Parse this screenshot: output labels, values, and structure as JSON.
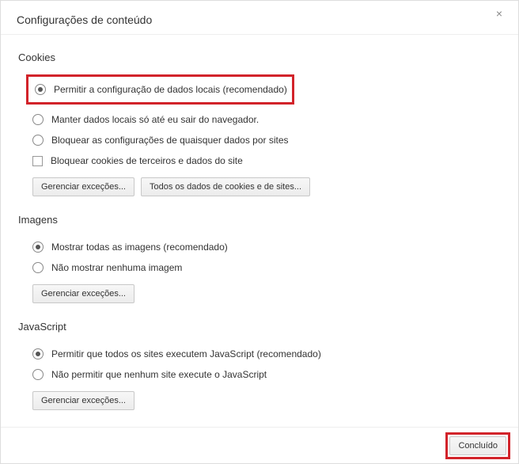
{
  "dialog": {
    "title": "Configurações de conteúdo",
    "close_label": "×"
  },
  "sections": {
    "cookies": {
      "title": "Cookies",
      "options": [
        {
          "label": "Permitir a configuração de dados locais (recomendado)",
          "checked": true
        },
        {
          "label": "Manter dados locais só até eu sair do navegador.",
          "checked": false
        },
        {
          "label": "Bloquear as configurações de quaisquer dados por sites",
          "checked": false
        }
      ],
      "checkbox": {
        "label": "Bloquear cookies de terceiros e dados do site",
        "checked": false
      },
      "buttons": {
        "manage": "Gerenciar exceções...",
        "alldata": "Todos os dados de cookies e de sites..."
      }
    },
    "images": {
      "title": "Imagens",
      "options": [
        {
          "label": "Mostrar todas as imagens (recomendado)",
          "checked": true
        },
        {
          "label": "Não mostrar nenhuma imagem",
          "checked": false
        }
      ],
      "buttons": {
        "manage": "Gerenciar exceções..."
      }
    },
    "javascript": {
      "title": "JavaScript",
      "options": [
        {
          "label": "Permitir que todos os sites executem JavaScript (recomendado)",
          "checked": true
        },
        {
          "label": "Não permitir que nenhum site execute o JavaScript",
          "checked": false
        }
      ],
      "buttons": {
        "manage": "Gerenciar exceções..."
      }
    }
  },
  "footer": {
    "done": "Concluído"
  }
}
